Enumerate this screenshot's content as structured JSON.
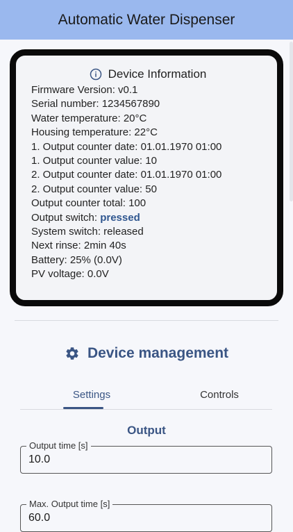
{
  "app": {
    "title": "Automatic Water Dispenser"
  },
  "device_info": {
    "title": "Device Information",
    "icon": "info-icon",
    "firmware": "Firmware Version: v0.1",
    "serial": "Serial number: 1234567890",
    "water_temp": "Water temperature: 20°C",
    "housing_temp": "Housing temperature: 22°C",
    "counter1_date": "1. Output counter date: 01.01.1970 01:00",
    "counter1_value": "1. Output counter value: 10",
    "counter2_date": "2. Output counter date: 01.01.1970 01:00",
    "counter2_value": "2. Output counter value: 50",
    "counter_total": "Output counter total: 100",
    "output_switch_label": "Output switch: ",
    "output_switch_value": "pressed",
    "system_switch": "System switch: released",
    "next_rinse": "Next rinse: 2min 40s",
    "battery": "Battery: 25% (0.0V)",
    "pv_voltage": "PV voltage: 0.0V"
  },
  "management": {
    "title": "Device management",
    "icon": "gear-icon",
    "tabs": [
      {
        "label": "Settings",
        "active": true
      },
      {
        "label": "Controls",
        "active": false
      }
    ],
    "section": "Output",
    "fields": [
      {
        "label": "Output time [s]",
        "value": "10.0"
      },
      {
        "label": "Max. Output time [s]",
        "value": "60.0"
      }
    ]
  },
  "colors": {
    "appbar": "#9ab8ee",
    "accent": "#3a5584",
    "highlight": "#2f568f",
    "background": "#f6f7fb"
  }
}
